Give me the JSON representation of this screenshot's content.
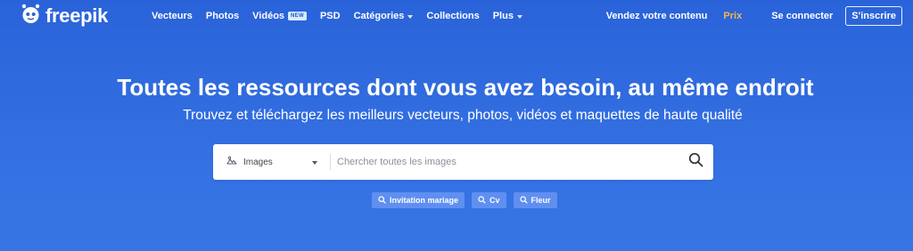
{
  "brand": {
    "name": "freepik"
  },
  "nav": {
    "items": [
      {
        "label": "Vecteurs"
      },
      {
        "label": "Photos"
      },
      {
        "label": "Vidéos",
        "badge": "NEW"
      },
      {
        "label": "PSD"
      },
      {
        "label": "Catégories",
        "dropdown": true
      },
      {
        "label": "Collections"
      },
      {
        "label": "Plus",
        "dropdown": true
      }
    ],
    "sell_label": "Vendez votre contenu",
    "pricing_label": "Prix",
    "login_label": "Se connecter",
    "signup_label": "S'inscrire"
  },
  "hero": {
    "title": "Toutes les ressources dont vous avez besoin, au même endroit",
    "subtitle": "Trouvez et téléchargez les meilleurs vecteurs, photos, vidéos et maquettes de haute qualité"
  },
  "search": {
    "type_selected": "Images",
    "placeholder": "Chercher toutes les images",
    "value": ""
  },
  "suggestions": [
    {
      "label": "Invitation mariage"
    },
    {
      "label": "Cv"
    },
    {
      "label": "Fleur"
    }
  ],
  "colors": {
    "background": "#3470e2",
    "pricing_accent": "#f7b54a",
    "tag_bg": "#5f8ff0"
  },
  "icons": {
    "logo": "freepik-logo-icon",
    "type": "images-icon",
    "search": "search-icon",
    "tag": "search-icon"
  }
}
